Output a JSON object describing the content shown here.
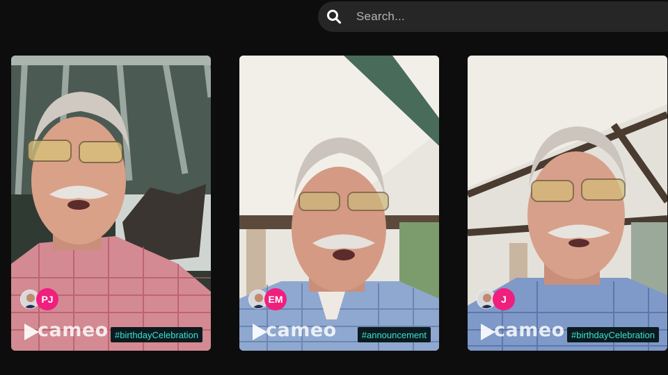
{
  "search": {
    "placeholder": "Search...",
    "icon": "search-icon"
  },
  "cards": [
    {
      "initials": "PJ",
      "logo": "cameo",
      "tag": "#birthdayCelebration"
    },
    {
      "initials": "EM",
      "logo": "cameo",
      "tag": "#announcement"
    },
    {
      "initials": "J",
      "logo": "cameo",
      "tag": "#birthdayCelebration"
    }
  ],
  "colors": {
    "background": "#0d0d0d",
    "search_bg": "#262626",
    "initials_badge": "#f01f7e",
    "tag_text": "#39e3d2",
    "tag_bg": "#0c1a1e"
  }
}
